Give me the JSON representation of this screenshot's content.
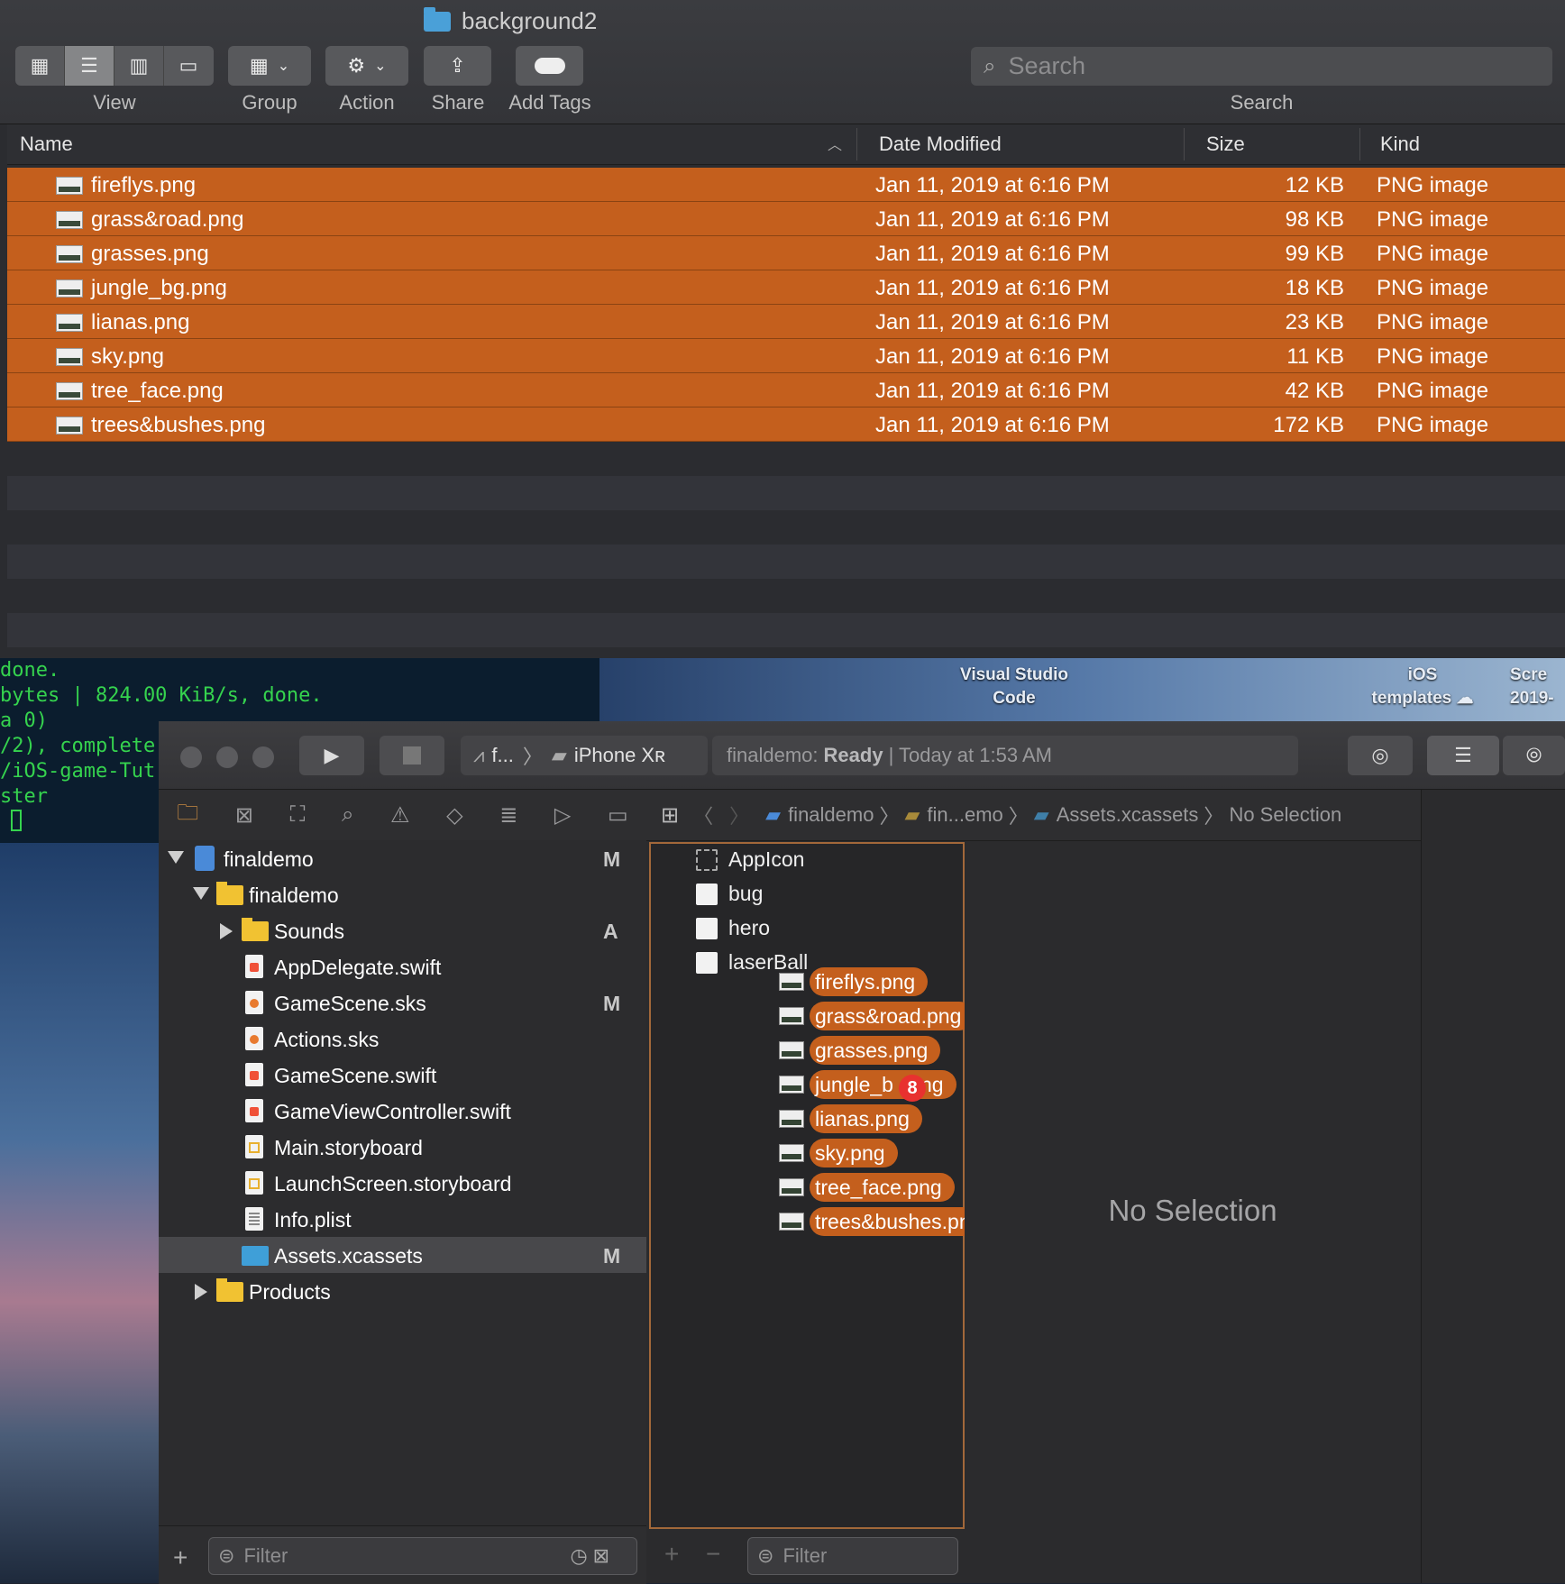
{
  "finder": {
    "folder_title": "background2",
    "toolbar": {
      "view_label": "View",
      "group_label": "Group",
      "action_label": "Action",
      "share_label": "Share",
      "add_tags_label": "Add Tags",
      "search_label": "Search",
      "search_placeholder": "Search"
    },
    "columns": {
      "name": "Name",
      "date": "Date Modified",
      "size": "Size",
      "kind": "Kind"
    },
    "files": [
      {
        "name": "fireflys.png",
        "date": "Jan 11, 2019 at 6:16 PM",
        "size": "12 KB",
        "kind": "PNG image"
      },
      {
        "name": "grass&road.png",
        "date": "Jan 11, 2019 at 6:16 PM",
        "size": "98 KB",
        "kind": "PNG image"
      },
      {
        "name": "grasses.png",
        "date": "Jan 11, 2019 at 6:16 PM",
        "size": "99 KB",
        "kind": "PNG image"
      },
      {
        "name": "jungle_bg.png",
        "date": "Jan 11, 2019 at 6:16 PM",
        "size": "18 KB",
        "kind": "PNG image"
      },
      {
        "name": "lianas.png",
        "date": "Jan 11, 2019 at 6:16 PM",
        "size": "23 KB",
        "kind": "PNG image"
      },
      {
        "name": "sky.png",
        "date": "Jan 11, 2019 at 6:16 PM",
        "size": "11 KB",
        "kind": "PNG image"
      },
      {
        "name": "tree_face.png",
        "date": "Jan 11, 2019 at 6:16 PM",
        "size": "42 KB",
        "kind": "PNG image"
      },
      {
        "name": "trees&bushes.png",
        "date": "Jan 11, 2019 at 6:16 PM",
        "size": "172 KB",
        "kind": "PNG image"
      }
    ]
  },
  "terminal": {
    "lines": [
      "done.",
      "bytes | 824.00 KiB/s, done.",
      "a 0)",
      "/2), complete",
      "/iOS-game-Tut",
      "ster"
    ]
  },
  "desktop": {
    "vscode_line1": "Visual Studio",
    "vscode_line2": "Code",
    "ios_line1": "iOS",
    "ios_line2": "templates",
    "scre_line1": "Scre",
    "scre_line2": "2019-"
  },
  "xcode": {
    "scheme_short": "f...",
    "device": "iPhone Xʀ",
    "status_project": "finaldemo:",
    "status_state": "Ready",
    "status_time": "| Today at 1:53 AM",
    "jump_bar": [
      "finaldemo",
      "fin...emo",
      "Assets.xcassets",
      "No Selection"
    ],
    "navigator": [
      {
        "label": "finaldemo",
        "badge": "M"
      },
      {
        "label": "finaldemo",
        "badge": ""
      },
      {
        "label": "Sounds",
        "badge": "A"
      },
      {
        "label": "AppDelegate.swift",
        "badge": ""
      },
      {
        "label": "GameScene.sks",
        "badge": "M"
      },
      {
        "label": "Actions.sks",
        "badge": ""
      },
      {
        "label": "GameScene.swift",
        "badge": ""
      },
      {
        "label": "GameViewController.swift",
        "badge": ""
      },
      {
        "label": "Main.storyboard",
        "badge": ""
      },
      {
        "label": "LaunchScreen.storyboard",
        "badge": ""
      },
      {
        "label": "Info.plist",
        "badge": ""
      },
      {
        "label": "Assets.xcassets",
        "badge": "M"
      },
      {
        "label": "Products",
        "badge": ""
      }
    ],
    "assets": [
      "AppIcon",
      "bug",
      "hero",
      "laserBall"
    ],
    "dragged_files": [
      "fireflys.png",
      "grass&road.png",
      "grasses.png",
      "jungle_b",
      "ng",
      "lianas.png",
      "sky.png",
      "tree_face.png",
      "trees&bushes.png"
    ],
    "drag_count": "8",
    "editor_placeholder": "No Selection",
    "filter_placeholder": "Filter",
    "asset_filter_placeholder": "Filter",
    "colors": {
      "selection": "#c45f1d",
      "badge_red": "#e8312f"
    }
  }
}
